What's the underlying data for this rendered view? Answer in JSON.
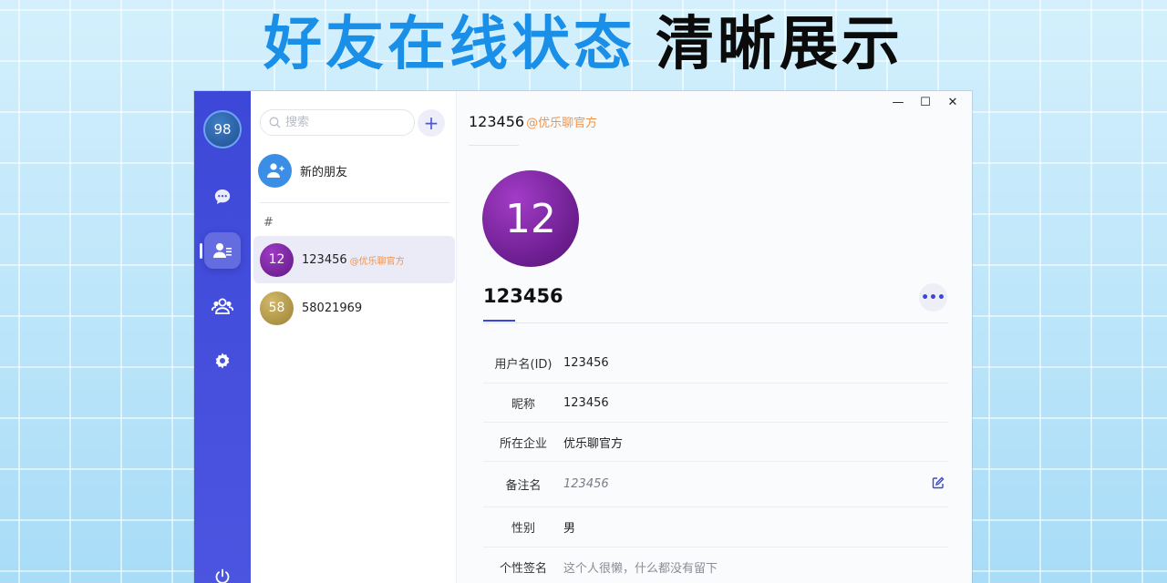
{
  "banner": {
    "highlight": "好友在线状态",
    "rest": "清晰展示"
  },
  "rail": {
    "my_avatar_text": "98",
    "items": [
      {
        "name": "chat",
        "icon": "chat-bubble-icon"
      },
      {
        "name": "contacts",
        "icon": "contacts-icon",
        "active": true
      },
      {
        "name": "groups",
        "icon": "group-icon"
      },
      {
        "name": "settings",
        "icon": "gear-icon"
      },
      {
        "name": "power",
        "icon": "power-icon"
      }
    ]
  },
  "contacts": {
    "search_placeholder": "搜索",
    "add_label": "+",
    "new_friends_label": "新的朋友",
    "section_letter": "#",
    "list": [
      {
        "avatar_text": "12",
        "name": "123456",
        "org": "@优乐聊官方",
        "selected": true,
        "avatar_color": "#7b1fa2"
      },
      {
        "avatar_text": "58",
        "name": "58021969",
        "org": "",
        "selected": false,
        "avatar_color": "#b59a4a"
      }
    ]
  },
  "window_controls": {
    "minimize": "—",
    "maximize": "☐",
    "close": "✕"
  },
  "detail": {
    "title": "123456",
    "title_org": "@优乐聊官方",
    "avatar_text": "12",
    "name": "123456",
    "more_label": "•••",
    "fields": [
      {
        "key": "用户名(ID)",
        "value": "123456",
        "style": "normal"
      },
      {
        "key": "昵称",
        "value": "123456",
        "style": "normal"
      },
      {
        "key": "所在企业",
        "value": "优乐聊官方",
        "style": "normal"
      },
      {
        "key": "备注名",
        "value": "123456",
        "style": "italic",
        "editable": true
      },
      {
        "key": "性别",
        "value": "男",
        "style": "normal"
      },
      {
        "key": "个性签名",
        "value": "这个人很懒，什么都没有留下",
        "style": "muted"
      }
    ]
  },
  "colors": {
    "accent": "#3b46d6",
    "rail": "#4450dc",
    "org_label": "#f0944b",
    "banner_blue": "#1a8fe8"
  }
}
